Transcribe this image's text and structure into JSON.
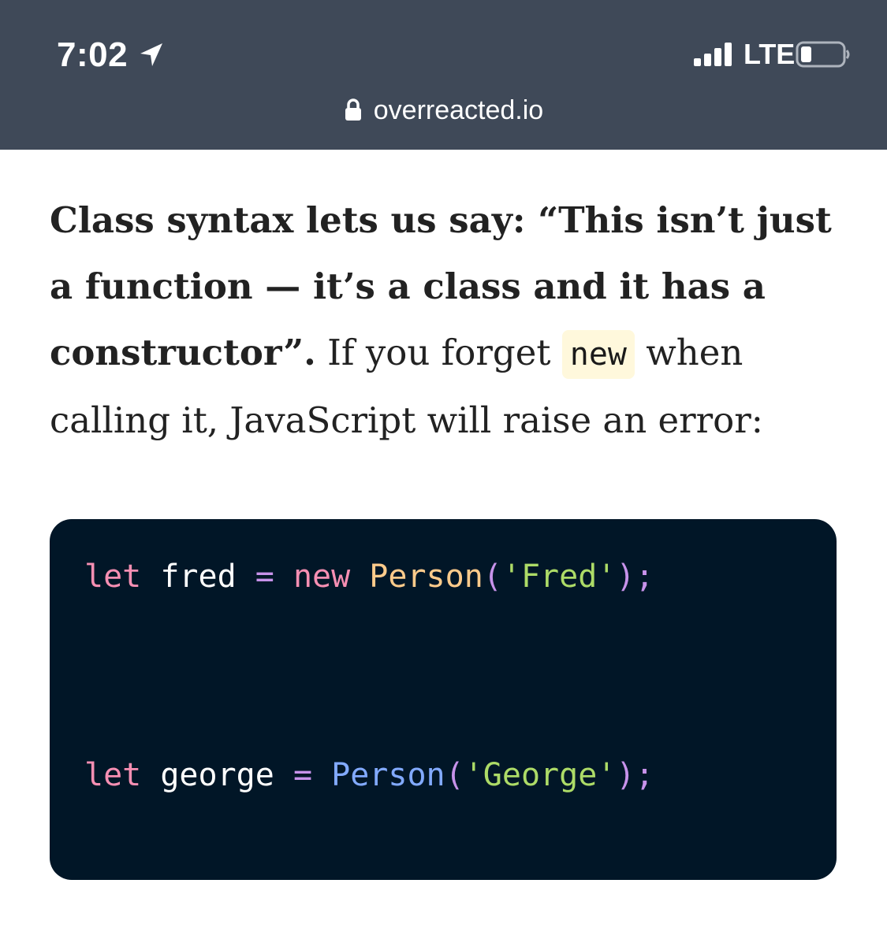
{
  "status_bar": {
    "time": "7:02",
    "network": "LTE",
    "url": "overreacted.io",
    "bg_color": "#3f4958"
  },
  "article": {
    "bold_text": "Class syntax lets us say: “This isn’t just a function — it’s a class and it has a constructor”.",
    "text_before_code": " If you forget ",
    "inline_code": "new",
    "text_after_code": " when calling it, JavaScript will raise an error:"
  },
  "code_block": {
    "bg_color": "#011627",
    "line1": {
      "kw": "let",
      "var": "fred",
      "op": "=",
      "new_kw": "new",
      "fn": "Person",
      "open": "(",
      "str": "'Fred'",
      "close": ")",
      "semi": ";"
    },
    "line2": {
      "kw": "let",
      "var": "george",
      "op": "=",
      "fn": "Person",
      "open": "(",
      "str": "'George'",
      "close": ")",
      "semi": ";"
    }
  },
  "icons": {
    "location": "location-arrow-icon",
    "signal": "cellular-signal-icon",
    "battery": "battery-icon",
    "lock": "lock-icon"
  }
}
